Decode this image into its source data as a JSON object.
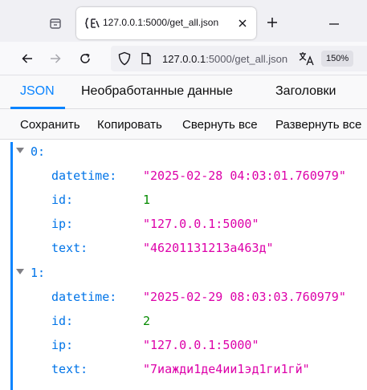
{
  "tab": {
    "title": "127.0.0.1:5000/get_all.json"
  },
  "nav": {
    "url_host": "127.0.0.1",
    "url_rest": ":5000/get_all.json",
    "zoom": "150%"
  },
  "viewer_tabs": [
    "JSON",
    "Необработанные данные",
    "Заголовки"
  ],
  "toolbar": {
    "save": "Сохранить",
    "copy": "Копировать",
    "collapse_all": "Свернуть все",
    "expand_all": "Развернуть все"
  },
  "records": [
    {
      "index": "0:",
      "fields": [
        {
          "key": "datetime:",
          "value": "\"2025-02-28 04:03:01.760979\"",
          "type": "string"
        },
        {
          "key": "id:",
          "value": "1",
          "type": "number"
        },
        {
          "key": "ip:",
          "value": "\"127.0.0.1:5000\"",
          "type": "string"
        },
        {
          "key": "text:",
          "value": "\"46201131213а463д\"",
          "type": "string"
        }
      ]
    },
    {
      "index": "1:",
      "fields": [
        {
          "key": "datetime:",
          "value": "\"2025-02-29 08:03:03.760979\"",
          "type": "string"
        },
        {
          "key": "id:",
          "value": "2",
          "type": "number"
        },
        {
          "key": "ip:",
          "value": "\"127.0.0.1:5000\"",
          "type": "string"
        },
        {
          "key": "text:",
          "value": "\"7иажди1де4ии1эд1ги1гй\"",
          "type": "string"
        }
      ]
    }
  ],
  "colors": {
    "accent": "#0a84ff",
    "json_key": "#0074e8",
    "json_string": "#dd00a9",
    "json_number": "#058b00"
  },
  "icons": [
    "tab-list-icon",
    "json-viewer-favicon",
    "close-icon",
    "plus-icon",
    "minimize-icon",
    "back-arrow-icon",
    "forward-arrow-icon",
    "reload-icon",
    "shield-icon",
    "page-icon",
    "translate-icon",
    "expand-triangle-icon"
  ]
}
